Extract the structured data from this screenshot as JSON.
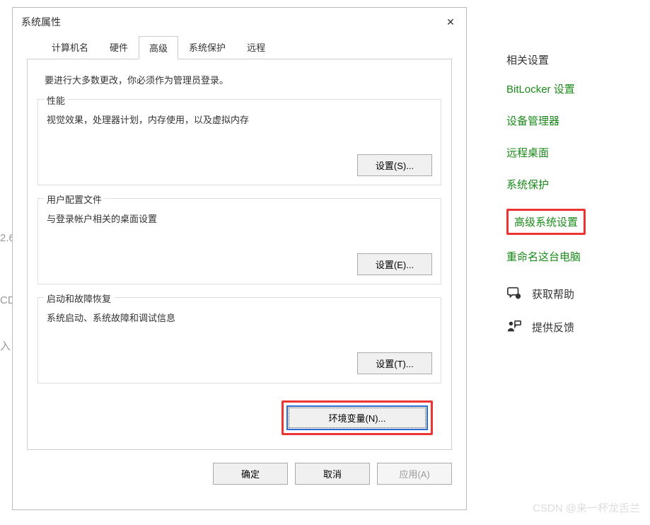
{
  "dialog": {
    "title": "系统属性",
    "close": "✕",
    "tabs": {
      "computer_name": "计算机名",
      "hardware": "硬件",
      "advanced": "高级",
      "system_protection": "系统保护",
      "remote": "远程"
    },
    "admin_note": "要进行大多数更改，你必须作为管理员登录。",
    "performance": {
      "title": "性能",
      "desc": "视觉效果，处理器计划，内存使用，以及虚拟内存",
      "button": "设置(S)..."
    },
    "user_profile": {
      "title": "用户配置文件",
      "desc": "与登录帐户相关的桌面设置",
      "button": "设置(E)..."
    },
    "startup": {
      "title": "启动和故障恢复",
      "desc": "系统启动、系统故障和调试信息",
      "button": "设置(T)..."
    },
    "env_var": "环境变量(N)...",
    "footer": {
      "ok": "确定",
      "cancel": "取消",
      "apply": "应用(A)"
    }
  },
  "rightpane": {
    "heading": "相关设置",
    "links": {
      "bitlocker": "BitLocker 设置",
      "device_mgr": "设备管理器",
      "remote_desktop": "远程桌面",
      "system_protection": "系统保护",
      "advanced_system": "高级系统设置",
      "rename_pc": "重命名这台电脑"
    },
    "iconlinks": {
      "get_help": "获取帮助",
      "feedback": "提供反馈"
    }
  },
  "bg": {
    "t1": "2.6",
    "t2": "CD",
    "t3": "入"
  },
  "watermark": "CSDN @来一杯龙舌兰"
}
